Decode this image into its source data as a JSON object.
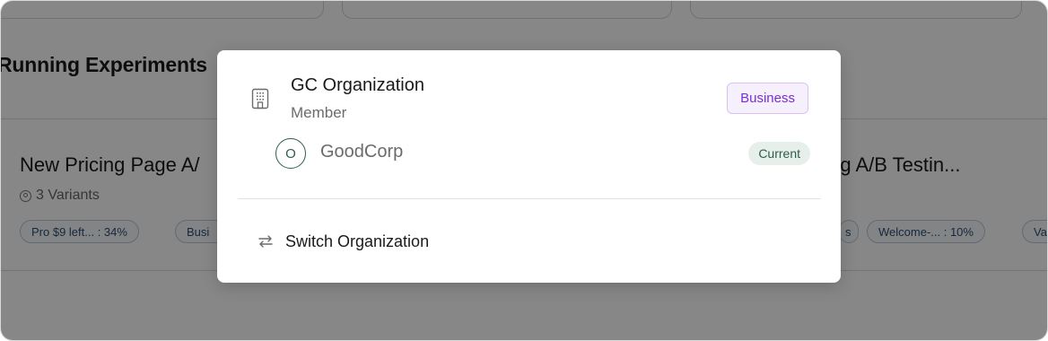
{
  "background": {
    "section_title": "Running Experiments",
    "experiments": [
      {
        "title": "New Pricing Page A/",
        "variants_text": "3 Variants",
        "chips": [
          "Pro $9 left... : 34%",
          "Busi"
        ]
      },
      {
        "title": "ding A/B Testin...",
        "chips": [
          "s",
          "Welcome-... : 10%",
          "Va"
        ]
      }
    ]
  },
  "modal": {
    "organization": {
      "name": "GC Organization",
      "role": "Member",
      "plan_badge": "Business",
      "icon": "building-icon"
    },
    "workspace": {
      "avatar_letter": "O",
      "name": "GoodCorp",
      "status_badge": "Current"
    },
    "switch_action": {
      "label": "Switch Organization",
      "icon": "switch-arrows-icon"
    }
  },
  "colors": {
    "overlay": "rgba(0,0,0,0.47)",
    "plan_badge_text": "#7a2fcf",
    "plan_badge_bg": "#f6f0fd",
    "workspace_accent": "#2f5d50",
    "current_badge_bg": "#e6efe9",
    "chip_text": "#2c4f78"
  }
}
